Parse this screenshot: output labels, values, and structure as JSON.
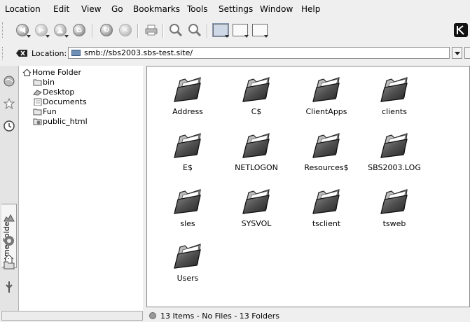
{
  "menubar": [
    "Location",
    "Edit",
    "View",
    "Go",
    "Bookmarks",
    "Tools",
    "Settings",
    "Window",
    "Help"
  ],
  "toolbar": {
    "buttons": [
      {
        "name": "back-icon",
        "glyph": "◀"
      },
      {
        "name": "forward-icon",
        "glyph": "▶"
      },
      {
        "name": "up-icon",
        "glyph": "▲"
      },
      {
        "name": "home-icon",
        "glyph": "⌂"
      },
      {
        "name": "reload-icon",
        "glyph": "↻"
      },
      {
        "name": "stop-icon",
        "glyph": "✕"
      },
      {
        "name": "print-icon",
        "glyph": ""
      },
      {
        "name": "zoom-in-icon",
        "glyph": ""
      },
      {
        "name": "zoom-out-icon",
        "glyph": ""
      }
    ]
  },
  "location_bar": {
    "label": "Location:",
    "value": "smb://sbs2003.sbs-test.site/"
  },
  "sidebar": {
    "tab_label": "Home Folder",
    "tree": [
      {
        "label": "Home Folder",
        "icon": "home-icon",
        "level": 0
      },
      {
        "label": "bin",
        "icon": "folder-icon",
        "level": 1
      },
      {
        "label": "Desktop",
        "icon": "desktop-icon",
        "level": 1
      },
      {
        "label": "Documents",
        "icon": "document-icon",
        "level": 1
      },
      {
        "label": "Fun",
        "icon": "folder-icon",
        "level": 1
      },
      {
        "label": "public_html",
        "icon": "web-folder-icon",
        "level": 1
      }
    ]
  },
  "main": {
    "items": [
      "Address",
      "C$",
      "ClientApps",
      "clients",
      "E$",
      "NETLOGON",
      "Resources$",
      "SBS2003.LOG",
      "sles",
      "SYSVOL",
      "tsclient",
      "tsweb",
      "Users"
    ]
  },
  "status": {
    "text": "13 Items - No Files - 13 Folders"
  }
}
